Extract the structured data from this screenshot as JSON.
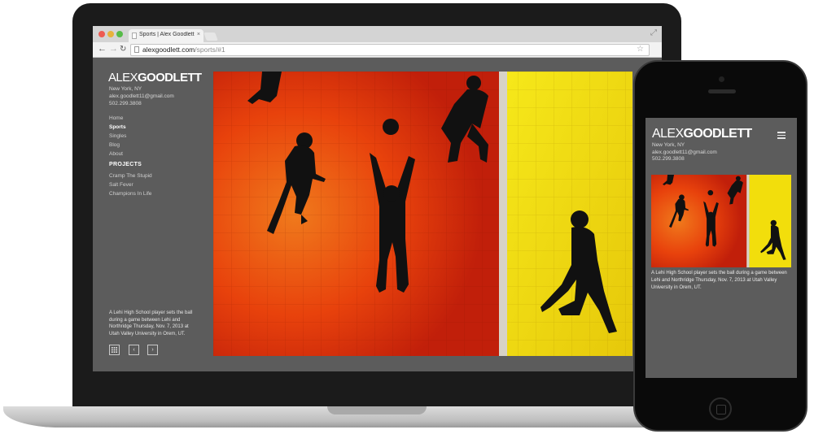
{
  "browser": {
    "tab_title": "Sports | Alex Goodlett Photo",
    "url_domain": "alexgoodlett.com",
    "url_path": "/sports/#1",
    "close_glyph": "×"
  },
  "site": {
    "logo_first": "ALEX",
    "logo_last": "GOODLETT",
    "location": "New York, NY",
    "email": "alex.goodlett11@gmail.com",
    "phone": "502.299.3808",
    "nav": [
      {
        "label": "Home",
        "active": false
      },
      {
        "label": "Sports",
        "active": true
      },
      {
        "label": "Singles",
        "active": false
      },
      {
        "label": "Blog",
        "active": false
      },
      {
        "label": "About",
        "active": false
      }
    ],
    "projects_heading": "PROJECTS",
    "projects": [
      "Cramp The Stupid",
      "Salt Fever",
      "Champions In Life"
    ],
    "caption": "A Lehi High School player sets the ball during a game between Lehi and Northridge Thursday, Nov. 7, 2013 at Utah Valley University in Orem, UT.",
    "controls": {
      "prev_glyph": "‹",
      "next_glyph": "›"
    }
  },
  "mobile": {
    "logo_first": "ALEX",
    "logo_last": "GOODLETT",
    "location": "New York, NY",
    "email": "alex.goodlett11@gmail.com",
    "phone": "502.299.3808",
    "caption": "A Lehi High School player sets the ball during a game between Lehi and Northridge Thursday, Nov. 7, 2013 at Utah Valley University in Orem, UT."
  },
  "colors": {
    "court_red": "#e8360a",
    "court_orange": "#f0781a",
    "court_yellow": "#f2de0c",
    "site_bg": "#5c5c5c"
  },
  "icons": [
    "grid-icon",
    "chevron-left-icon",
    "chevron-right-icon",
    "menu-icon",
    "star-icon",
    "reload-icon",
    "back-arrow-icon",
    "forward-arrow-icon"
  ]
}
